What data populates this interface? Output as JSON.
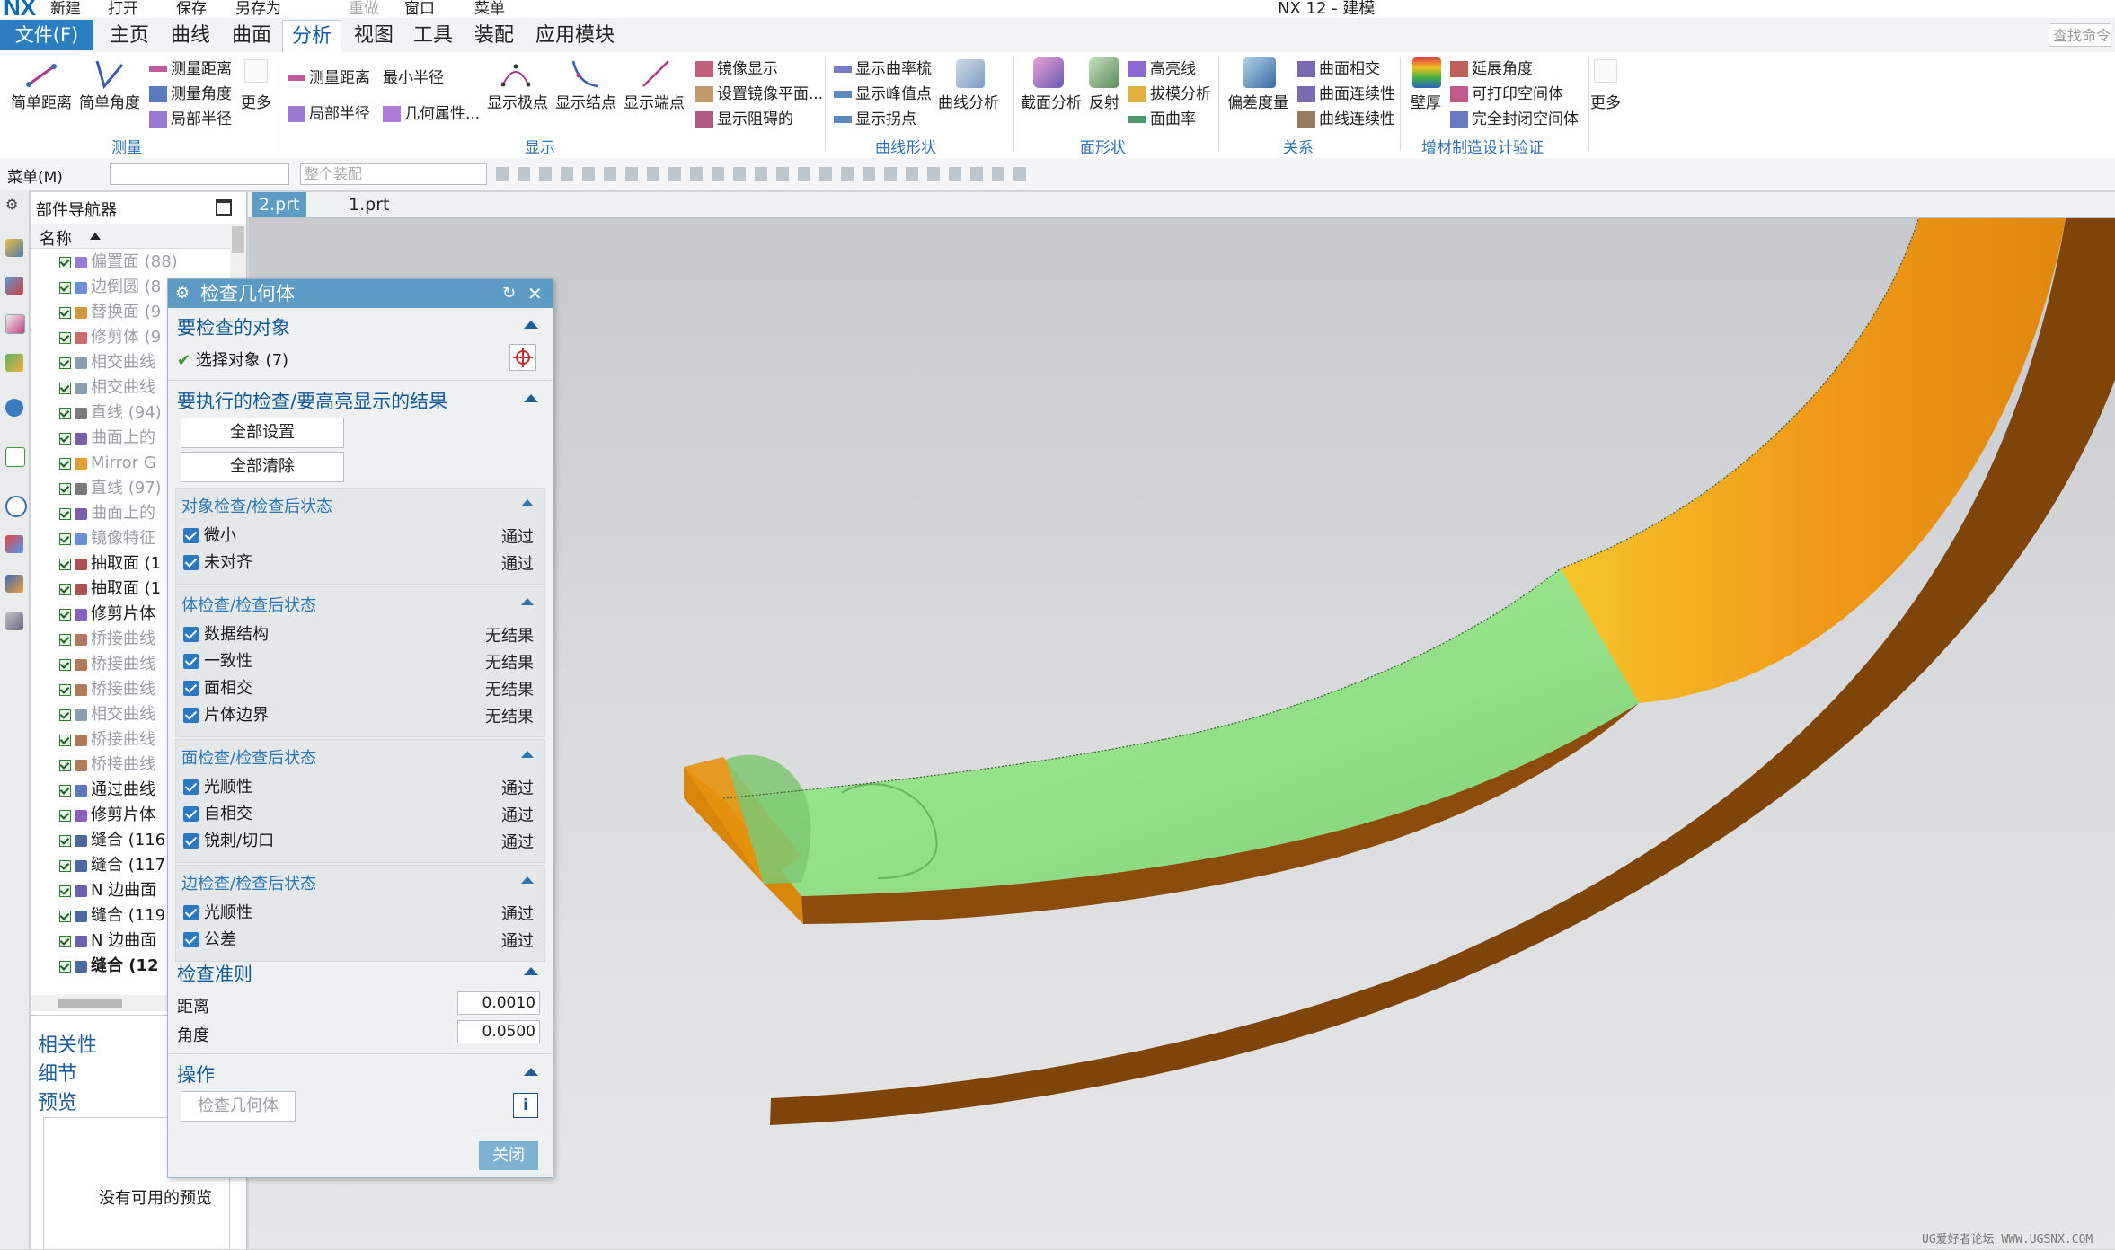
{
  "titlebar": {
    "logo": "NX",
    "qa_new": "新建",
    "qa_open": "打开",
    "qa_save": "保存",
    "qa_saveas": "另存为",
    "qa_redo": "重做",
    "qa_window": "窗口",
    "qa_menu": "菜单",
    "title": "NX 12 - 建模"
  },
  "menubar": {
    "file": "文件(F)",
    "tabs": [
      "主页",
      "曲线",
      "曲面",
      "分析",
      "视图",
      "工具",
      "装配",
      "应用模块"
    ],
    "active": "分析",
    "search_placeholder": "查找命令"
  },
  "ribbon": {
    "measure": {
      "simple_distance": "简单距离",
      "simple_angle": "简单角度",
      "measure_distance": "测量距离",
      "measure_angle": "测量角度",
      "local_radius": "局部半径",
      "more": "更多",
      "group": "测量"
    },
    "display": {
      "measure_distance": "测量距离",
      "min_radius": "最小半径",
      "local_radius": "局部半径",
      "geom_props": "几何属性...",
      "show_poles": "显示极点",
      "show_knots": "显示结点",
      "show_endpoints": "显示端点",
      "mirror_display": "镜像显示",
      "set_mirror_plane": "设置镜像平面...",
      "show_obstruction": "显示阻碍的",
      "group": "显示"
    },
    "curve_shape": {
      "show_comb": "显示曲率梳",
      "show_peaks": "显示峰值点",
      "show_inflections": "显示拐点",
      "curve_analysis": "曲线分析",
      "group": "曲线形状"
    },
    "face_shape": {
      "section_analysis": "截面分析",
      "reflection": "反射",
      "highlight_lines": "高亮线",
      "draft_analysis": "拔模分析",
      "face_curvature": "面曲率",
      "group": "面形状"
    },
    "relation": {
      "deviation": "偏差度量",
      "face_intersect": "曲面相交",
      "face_continuity": "曲面连续性",
      "curve_continuity": "曲线连续性",
      "group": "关系"
    },
    "am": {
      "wall": "壁厚",
      "overhang": "延展角度",
      "printable_void": "可打印空间体",
      "closed_void": "完全封闭空间体",
      "more": "更多",
      "group": "增材制造设计验证"
    }
  },
  "toolbar": {
    "menu": "菜单(M)",
    "filter_placeholder": "",
    "assembly": "整个装配"
  },
  "doctabs": [
    {
      "label": "2.prt",
      "active": true
    },
    {
      "label": "1.prt",
      "active": false
    }
  ],
  "navigator": {
    "title": "部件导航器",
    "column": "名称",
    "rows": [
      {
        "label": "偏置面 (88)",
        "grey": true,
        "color": "#9c7bd6"
      },
      {
        "label": "边倒圆 (8",
        "grey": true,
        "color": "#6a8fd8"
      },
      {
        "label": "替换面 (9",
        "grey": true,
        "color": "#d0983a"
      },
      {
        "label": "修剪体 (9",
        "grey": true,
        "color": "#d06a6a"
      },
      {
        "label": "相交曲线",
        "grey": true,
        "color": "#8a9fb0"
      },
      {
        "label": "相交曲线",
        "grey": true,
        "color": "#8a9fb0"
      },
      {
        "label": "直线 (94)",
        "grey": true,
        "color": "#7a7a7a"
      },
      {
        "label": "曲面上的",
        "grey": true,
        "color": "#7a5fa8"
      },
      {
        "label": "Mirror G",
        "grey": true,
        "color": "#e0a030"
      },
      {
        "label": "直线 (97)",
        "grey": true,
        "color": "#7a7a7a"
      },
      {
        "label": "曲面上的",
        "grey": true,
        "color": "#7a5fa8"
      },
      {
        "label": "镜像特征",
        "grey": true,
        "color": "#6a8fd8"
      },
      {
        "label": "抽取面 (1",
        "grey": false,
        "color": "#b05050"
      },
      {
        "label": "抽取面 (1",
        "grey": false,
        "color": "#b05050"
      },
      {
        "label": "修剪片体",
        "grey": false,
        "color": "#8a5fc0"
      },
      {
        "label": "桥接曲线",
        "grey": true,
        "color": "#b07a5a"
      },
      {
        "label": "桥接曲线",
        "grey": true,
        "color": "#b07a5a"
      },
      {
        "label": "桥接曲线",
        "grey": true,
        "color": "#b07a5a"
      },
      {
        "label": "相交曲线",
        "grey": true,
        "color": "#8a9fb0"
      },
      {
        "label": "桥接曲线",
        "grey": true,
        "color": "#b07a5a"
      },
      {
        "label": "桥接曲线",
        "grey": true,
        "color": "#b07a5a"
      },
      {
        "label": "通过曲线",
        "grey": false,
        "color": "#5a7ac0"
      },
      {
        "label": "修剪片体",
        "grey": false,
        "color": "#8a5fc0"
      },
      {
        "label": "缝合 (116",
        "grey": false,
        "color": "#4a6aa0"
      },
      {
        "label": "缝合 (117",
        "grey": false,
        "color": "#4a6aa0"
      },
      {
        "label": "N 边曲面",
        "grey": false,
        "color": "#6a5fb0"
      },
      {
        "label": "缝合 (119",
        "grey": false,
        "color": "#4a6aa0"
      },
      {
        "label": "N 边曲面",
        "grey": false,
        "color": "#6a5fb0"
      },
      {
        "label": "缝合 (12",
        "grey": false,
        "bold": true,
        "color": "#4a6aa0"
      }
    ],
    "panels": {
      "dependencies": "相关性",
      "details": "细节",
      "preview": "预览",
      "no_preview": "没有可用的预览"
    }
  },
  "dialog": {
    "title": "检查几何体",
    "sec_objects": "要检查的对象",
    "select_objects": "选择对象 (7)",
    "sec_checks": "要执行的检查/要高亮显示的结果",
    "set_all": "全部设置",
    "clear_all": "全部清除",
    "groups": [
      {
        "title": "对象检查/检查后状态",
        "items": [
          {
            "label": "微小",
            "result": "通过"
          },
          {
            "label": "未对齐",
            "result": "通过"
          }
        ]
      },
      {
        "title": "体检查/检查后状态",
        "items": [
          {
            "label": "数据结构",
            "result": "无结果"
          },
          {
            "label": "一致性",
            "result": "无结果"
          },
          {
            "label": "面相交",
            "result": "无结果"
          },
          {
            "label": "片体边界",
            "result": "无结果"
          }
        ]
      },
      {
        "title": "面检查/检查后状态",
        "items": [
          {
            "label": "光顺性",
            "result": "通过"
          },
          {
            "label": "自相交",
            "result": "通过"
          },
          {
            "label": "锐刺/切口",
            "result": "通过"
          }
        ]
      },
      {
        "title": "边检查/检查后状态",
        "items": [
          {
            "label": "光顺性",
            "result": "通过"
          },
          {
            "label": "公差",
            "result": "通过"
          }
        ]
      }
    ],
    "sec_criteria": "检查准则",
    "distance_label": "距离",
    "distance_value": "0.0010",
    "angle_label": "角度",
    "angle_value": "0.0500",
    "sec_operations": "操作",
    "check_button": "检查几何体",
    "close_button": "关闭"
  },
  "watermark": "UG爱好者论坛 WWW.UGSNX.COM",
  "colors": {
    "accent": "#2b7fc1",
    "dialog_header": "#5b9bc4",
    "green_face": "#8fdc84",
    "orange_face": "#f3a11a",
    "brown_side": "#8a4c0a"
  }
}
